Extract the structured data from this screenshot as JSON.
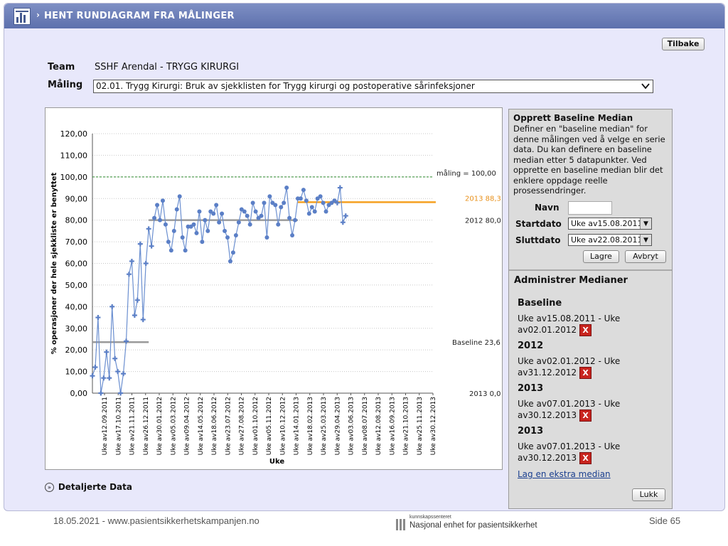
{
  "header": {
    "title": "HENT RUNDIAGRAM FRA MÅLINGER",
    "back_label": "Tilbake"
  },
  "form": {
    "team_label": "Team",
    "team_value": "SSHF Arendal - TRYGG KIRURGI",
    "measure_label": "Måling",
    "measure_value": "02.01. Trygg Kirurgi: Bruk av sjekklisten for Trygg kirurgi og postoperative sårinfeksjoner"
  },
  "chart_data": {
    "type": "line",
    "ylabel": "% operasjoner der hele sjekkliste er benyttet",
    "xlabel": "Uke",
    "ylim": [
      0,
      120
    ],
    "yticks": [
      "0,00",
      "10,00",
      "20,00",
      "30,00",
      "40,00",
      "50,00",
      "60,00",
      "70,00",
      "80,00",
      "90,00",
      "100,00",
      "110,00",
      "120,00"
    ],
    "xtick_labels": [
      "Uke av12.09.2011",
      "Uke av17.10.2011",
      "Uke av21.11.2011",
      "Uke av26.12.2011",
      "Uke av30.01.2012",
      "Uke av05.03.2012",
      "Uke av09.04.2012",
      "Uke av14.05.2012",
      "Uke av18.06.2012",
      "Uke av23.07.2012",
      "Uke av27.08.2012",
      "Uke av01.10.2012",
      "Uke av05.11.2012",
      "Uke av10.12.2012",
      "Uke av14.01.2013",
      "Uke av18.02.2013",
      "Uke av25.03.2013",
      "Uke av29.04.2013",
      "Uke av03.06.2013",
      "Uke av08.07.2013",
      "Uke av12.08.2013",
      "Uke av16.09.2013",
      "Uke av21.10.2013",
      "Uke av25.11.2013",
      "Uke av30.12.2013"
    ],
    "num_weeks": 122,
    "series": [
      {
        "values": [
          8,
          12,
          35,
          0,
          7,
          19,
          7,
          40,
          16,
          10,
          0,
          9,
          24,
          55,
          61,
          36,
          43,
          69,
          34,
          60,
          76,
          68,
          81,
          87,
          80,
          89,
          78,
          70,
          66,
          75,
          85,
          91,
          72,
          66,
          77,
          77,
          78,
          74,
          84,
          70,
          80,
          75,
          84,
          83,
          87,
          79,
          83,
          75,
          72,
          61,
          65,
          73,
          79,
          85,
          84,
          82,
          78,
          88,
          84,
          81,
          82,
          88,
          72,
          91,
          88,
          87,
          78,
          86,
          88,
          95,
          81,
          73,
          80,
          90,
          90,
          94,
          89,
          83,
          86,
          84,
          90,
          91,
          88,
          84,
          87,
          88,
          89,
          88,
          95,
          79,
          82
        ]
      }
    ],
    "reference_lines": [
      {
        "label": "måling = 100,00",
        "value": 100,
        "color": "#2e8b2e",
        "style": "dashed"
      },
      {
        "label": "2013 88,3",
        "value": 88.3,
        "color": "#f5a020",
        "from_week": 73,
        "to_week": 122
      },
      {
        "label": "2012 80,0",
        "value": 80.0,
        "color": "#9a9a9a",
        "from_week": 20,
        "to_week": 73
      },
      {
        "label": "Baseline 23,6",
        "value": 23.6,
        "color": "#9a9a9a",
        "from_week": 0,
        "to_week": 20
      },
      {
        "label": "2013 0,0",
        "value": 0,
        "color": "#9a9a9a",
        "from_week": 73,
        "to_week": 122
      }
    ]
  },
  "baseline_panel": {
    "title": "Opprett Baseline Median",
    "description": "Definer en \"baseline median\" for denne målingen ved å velge en serie data. Du kan definere en baseline median etter 5 datapunkter. Ved opprette en baseline median blir det enklere oppdage reelle prosessendringer.",
    "name_label": "Navn",
    "name_value": "",
    "start_label": "Startdato",
    "start_value": "Uke av15.08.2011",
    "end_label": "Sluttdato",
    "end_value": "Uke av22.08.2011",
    "save_label": "Lagre",
    "cancel_label": "Avbryt"
  },
  "admin_panel": {
    "title": "Administrer Medianer",
    "medians": [
      {
        "name": "Baseline",
        "range": "Uke av15.08.2011 - Uke av02.01.2012"
      },
      {
        "name": "2012",
        "range": "Uke av02.01.2012 - Uke av31.12.2012"
      },
      {
        "name": "2013",
        "range": "Uke av07.01.2013 - Uke av30.12.2013"
      },
      {
        "name": "2013",
        "range": "Uke av07.01.2013 - Uke av30.12.2013"
      }
    ],
    "delete_glyph": "X",
    "extra_link": "Lag en ekstra median",
    "close_label": "Lukk"
  },
  "details_label": "Detaljerte Data",
  "footer": {
    "left": "18.05.2021 - www.pasientsikkerhetskampanjen.no",
    "logo_small": "kunnskapssenteret",
    "logo_main": "Nasjonal enhet for pasientsikkerhet",
    "right": "Side 65"
  }
}
